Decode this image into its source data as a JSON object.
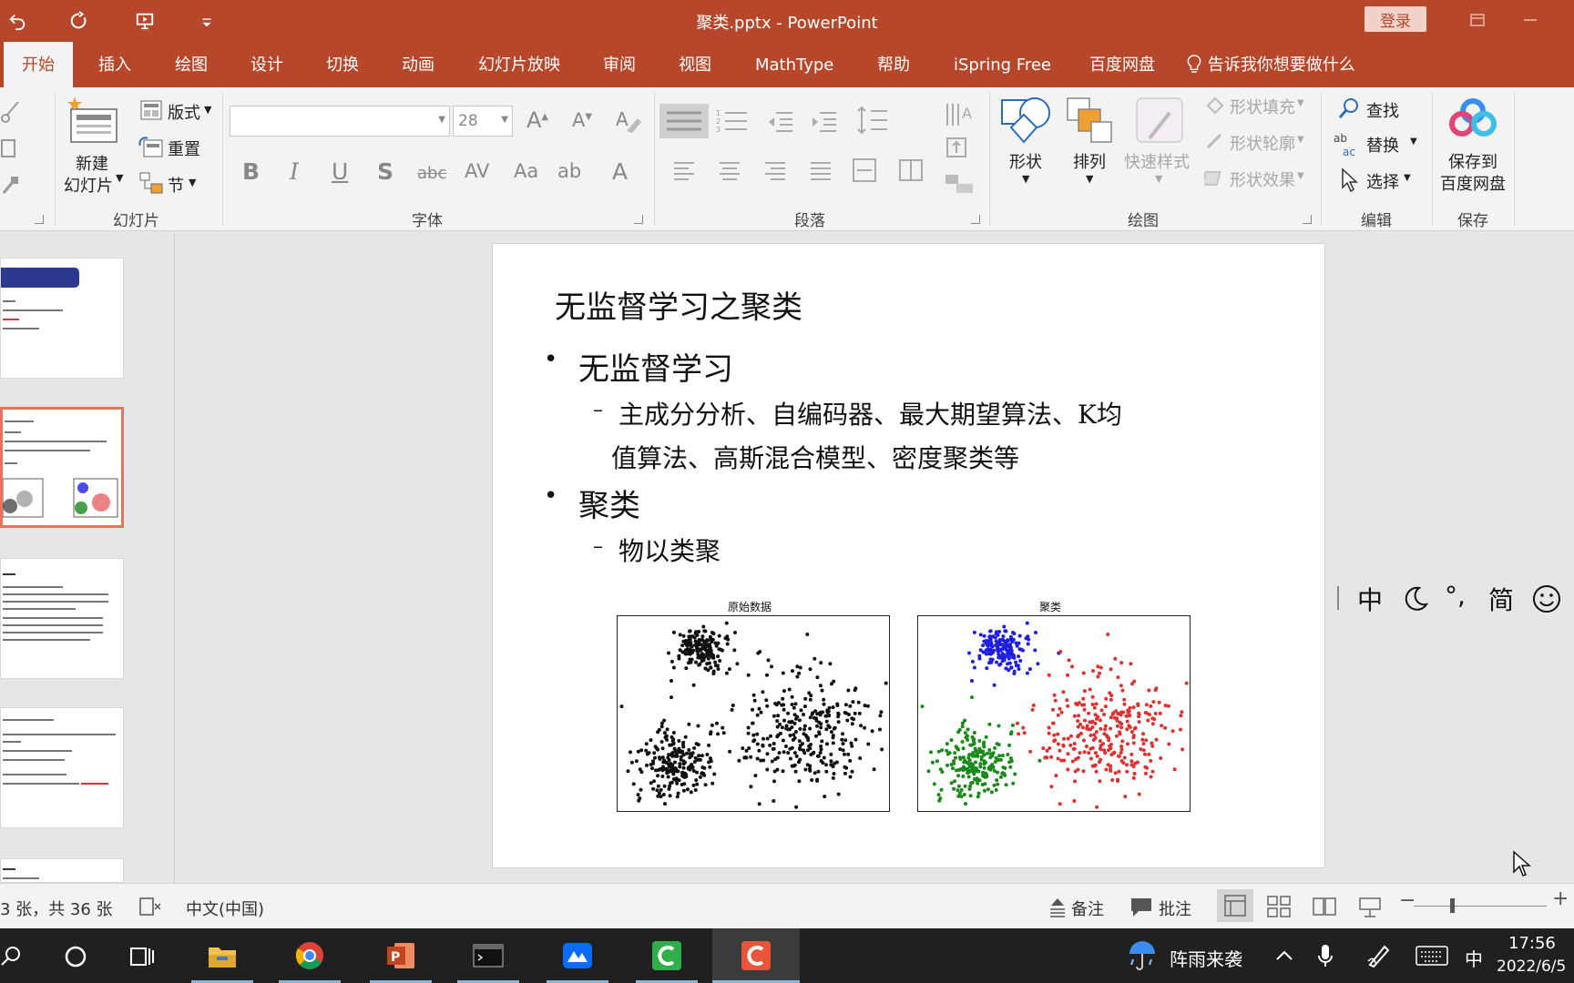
{
  "window": {
    "title": "聚类.pptx  -  PowerPoint",
    "login_label": "登录"
  },
  "tabs": [
    "开始",
    "插入",
    "绘图",
    "设计",
    "切换",
    "动画",
    "幻灯片放映",
    "审阅",
    "视图",
    "MathType",
    "帮助",
    "iSpring Free",
    "百度网盘"
  ],
  "tell_me": "告诉我你想要做什么",
  "ribbon": {
    "slides": {
      "label": "幻灯片",
      "new_slide_line1": "新建",
      "new_slide_line2": "幻灯片",
      "layout": "版式",
      "reset": "重置",
      "section": "节"
    },
    "font": {
      "label": "字体",
      "font_name": "",
      "font_size": "28"
    },
    "paragraph": {
      "label": "段落"
    },
    "drawing": {
      "label": "绘图",
      "shapes": "形状",
      "arrange": "排列",
      "quick_styles": "快速样式",
      "shape_fill": "形状填充",
      "shape_outline": "形状轮廓",
      "shape_effects": "形状效果"
    },
    "editing": {
      "label": "编辑",
      "find": "查找",
      "replace": "替换",
      "select": "选择"
    },
    "save": {
      "label": "保存",
      "save_line1": "保存到",
      "save_line2": "百度网盘"
    }
  },
  "slide": {
    "title": "无监督学习之聚类",
    "bullet1": "无监督学习",
    "sub1_line1": "主成分分析、自编码器、最大期望算法、K均",
    "sub1_line2": "值算法、高斯混合模型、密度聚类等",
    "bullet2": "聚类",
    "sub2": "物以类聚",
    "plot_left_title": "原始数据",
    "plot_right_title": "聚类"
  },
  "ime": {
    "lang": "中",
    "punct": "°,",
    "simp": "简"
  },
  "statusbar": {
    "slide_count": "3 张，共 36 张",
    "language": "中文(中国)",
    "notes": "备注",
    "comments": "批注"
  },
  "taskbar": {
    "weather": "阵雨来袭",
    "ime_lang": "中",
    "time": "17:56",
    "date": "2022/6/5"
  },
  "colors": {
    "accent": "#b7472a",
    "cluster_blue": "#1f1fe0",
    "cluster_green": "#1a8a1a",
    "cluster_red": "#e03030"
  }
}
